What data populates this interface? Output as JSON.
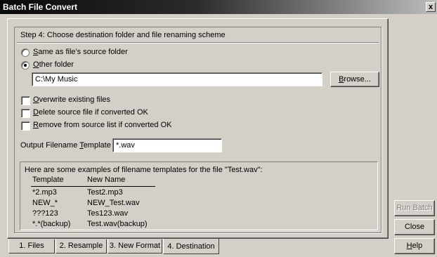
{
  "window": {
    "title": "Batch File Convert",
    "close_glyph": "x"
  },
  "step": {
    "heading": "Step 4:  Choose destination folder and file renaming scheme"
  },
  "destination": {
    "same_folder_label": "Same as file's source folder",
    "other_folder_label": "Other folder",
    "selected": "other",
    "folder_path": "C:\\My Music",
    "browse_label": "Browse..."
  },
  "options": [
    {
      "label": "Overwrite existing files",
      "checked": false
    },
    {
      "label": "Delete source file if converted OK",
      "checked": false
    },
    {
      "label": "Remove from source list if converted OK",
      "checked": false
    }
  ],
  "template": {
    "label": "Output Filename Template",
    "value": "*.wav"
  },
  "examples": {
    "intro": "Here are some examples of filename templates for the file \"Test.wav\":",
    "headers": [
      "Template",
      "New Name"
    ],
    "rows": [
      [
        "*2.mp3",
        "Test2.mp3"
      ],
      [
        "NEW_*",
        "NEW_Test.wav"
      ],
      [
        "???123",
        "Tes123.wav"
      ],
      [
        "*.*(backup)",
        "Test.wav(backup)"
      ]
    ]
  },
  "buttons": {
    "run_batch": "Run Batch",
    "close": "Close",
    "help": "Help"
  },
  "tabs": [
    "1. Files",
    "2. Resample",
    "3. New Format",
    "4. Destination"
  ],
  "active_tab": 3
}
